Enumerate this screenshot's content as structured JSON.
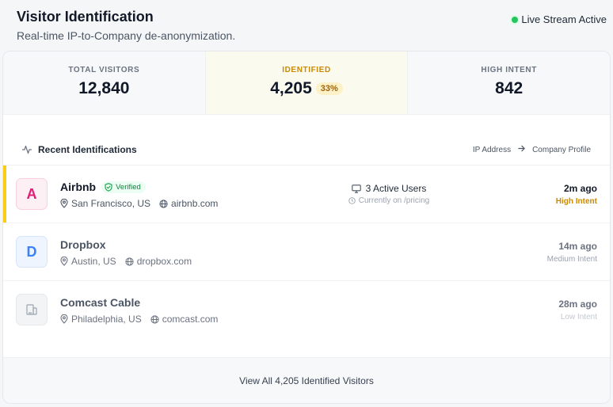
{
  "header": {
    "title": "Visitor Identification",
    "subtitle": "Real-time IP-to-Company de-anonymization.",
    "live_label": "Live Stream Active",
    "live_color": "#22c55e"
  },
  "stats": [
    {
      "label": "TOTAL VISITORS",
      "value": "12,840"
    },
    {
      "label": "IDENTIFIED",
      "value": "4,205",
      "badge": "33%"
    },
    {
      "label": "HIGH INTENT",
      "value": "842"
    }
  ],
  "section": {
    "title": "Recent Identifications",
    "flow_from": "IP Address",
    "flow_to": "Company Profile"
  },
  "rows": [
    {
      "initial": "A",
      "name": "Airbnb",
      "verified": "Verified",
      "location": "San Francisco, US",
      "domain": "airbnb.com",
      "active_users": "3 Active Users",
      "current_page": "Currently on /pricing",
      "time": "2m ago",
      "intent": "High Intent",
      "intent_color": "#ca8a04"
    },
    {
      "initial": "D",
      "name": "Dropbox",
      "location": "Austin, US",
      "domain": "dropbox.com",
      "time": "14m ago",
      "intent": "Medium Intent",
      "intent_color": "#9ca3af"
    },
    {
      "icon": "building-icon",
      "name": "Comcast Cable",
      "location": "Philadelphia, US",
      "domain": "comcast.com",
      "time": "28m ago",
      "intent": "Low Intent",
      "intent_color": "#c3c7ce"
    }
  ],
  "footer": {
    "link_label": "View All 4,205 Identified Visitors"
  },
  "colors": {
    "accent": "#facc15",
    "verified_green": "#15803d"
  }
}
